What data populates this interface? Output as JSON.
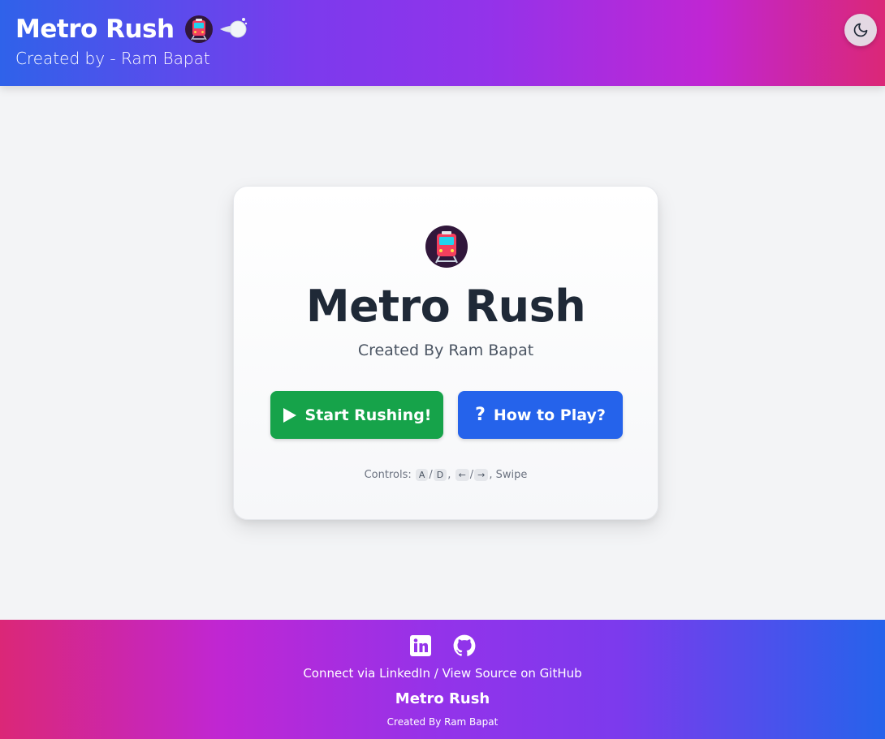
{
  "header": {
    "title": "Metro Rush",
    "subtitle": "Created by - Ram Bapat",
    "icons": [
      "metro-train-icon",
      "dash-speed-icon"
    ],
    "theme_toggle_icon": "moon-icon"
  },
  "card": {
    "icon": "metro-train-icon",
    "title": "Metro Rush",
    "subtitle": "Created By Ram Bapat",
    "start_button": {
      "label": "Start Rushing!",
      "icon": "play-icon",
      "color": "#16a34a"
    },
    "how_button": {
      "label": "How to Play?",
      "icon": "question-icon",
      "color": "#2563eb"
    },
    "controls": {
      "prefix": "Controls:",
      "key_a": "A",
      "sep1": "/",
      "key_d": "D",
      "comma1": ",",
      "key_left": "←",
      "sep2": "/",
      "key_right": "→",
      "suffix": ", Swipe"
    }
  },
  "footer": {
    "icons": [
      "linkedin-icon",
      "github-icon"
    ],
    "connect_text": "Connect via LinkedIn / View Source on GitHub",
    "title": "Metro Rush",
    "credit": "Created By Ram Bapat"
  },
  "colors": {
    "header_gradient": [
      "#2f62ea",
      "#9333ea",
      "#db2777"
    ],
    "footer_gradient": [
      "#db2777",
      "#9333ea",
      "#2563eb"
    ],
    "title_text": "#1f2937"
  }
}
